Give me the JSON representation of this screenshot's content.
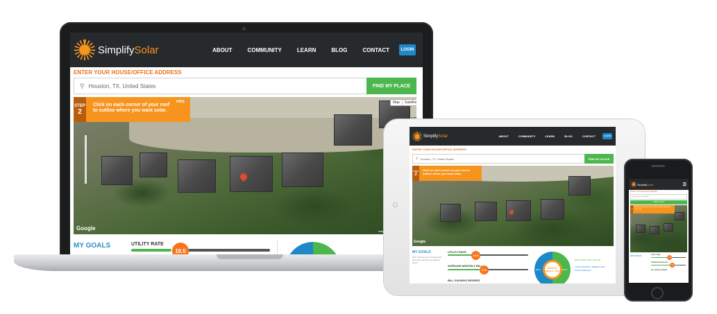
{
  "site": {
    "brand_part1": "Simplify",
    "brand_part2": "Solar",
    "nav_about": "ABOUT",
    "nav_community": "COMMUNITY",
    "nav_learn": "LEARN",
    "nav_blog": "BLOG",
    "nav_contact": "CONTACT",
    "login": "LOGIN",
    "address_label": "ENTER YOUR HOUSE/OFFICE ADDRESS",
    "search_value": "Houston, TX, United States",
    "find_button": "FIND MY PLACE",
    "step_word": "STEP",
    "step_number": "2",
    "step_text": "Click on each corner of your roof to outline where you want solar.",
    "hide": "HIDE",
    "map_type_map": "Map",
    "map_type_satellite": "Satellite",
    "google": "Google",
    "imagery": "Imagery ©2015",
    "terms": "Terms of Use",
    "goals_title": "MY GOALS",
    "goals_text": "How much do you currently pay and how much do you want to save?",
    "utility_rate_label": "UTILITY RATE",
    "utility_rate_value": "10.5",
    "monthly_bill_label": "AVERAGE MONTHLY BILL",
    "monthly_bill_value": "270",
    "bill_savings_label": "BILL SAVINGS DESIRED",
    "donut_center": "MONTHLY ENERGY COST",
    "donut_left": "$140",
    "donut_right": "$140",
    "save_with_solar": "$140 SAVED WITH SOLAR",
    "new_bill": "YOUR MONTHLY ENERGY BILL WOULD BE $140",
    "scale_min": "8.5¢/kWh",
    "scale_max": "24.5¢/kWh"
  },
  "colors": {
    "nav_bg": "#272a2d",
    "accent_orange": "#f7941d",
    "find_green": "#4cb74c",
    "login_blue": "#1e88c9",
    "goals_blue": "#2a8ec9"
  }
}
